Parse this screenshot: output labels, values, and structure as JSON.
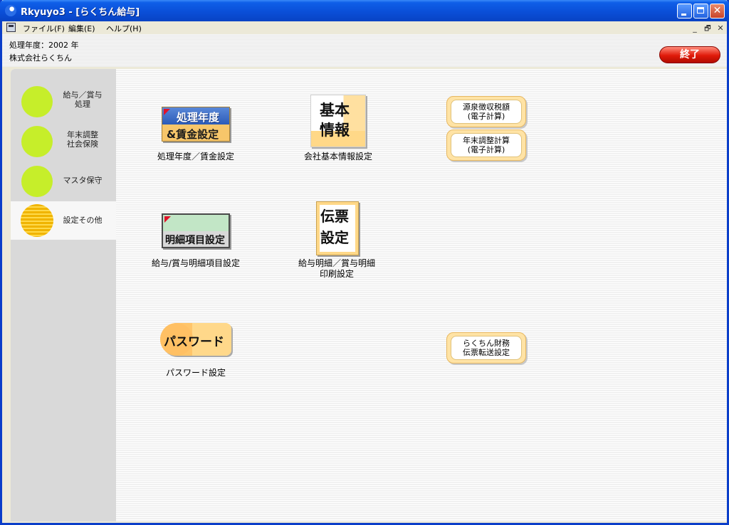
{
  "window": {
    "title": "Rkyuyo3 - [らくちん給与]",
    "buttons": {
      "minimize": "_",
      "maximize": "□",
      "close": "✕"
    }
  },
  "menu": {
    "items": [
      "ファイル(F)",
      "編集(E)",
      "ヘルプ(H)"
    ],
    "mdi": {
      "minimize": "_",
      "restore": "🗗",
      "close": "✕"
    }
  },
  "info": {
    "year_line": "処理年度：2002 年",
    "company": "株式会社らくちん",
    "exit_label": "終了"
  },
  "sidebar": {
    "items": [
      {
        "lines": [
          "給与／賞与",
          "処理"
        ]
      },
      {
        "lines": [
          "年末調整",
          "社会保険"
        ]
      },
      {
        "lines": [
          "マスタ保守"
        ]
      },
      {
        "lines": [
          "設定その他"
        ]
      }
    ],
    "active_index": 3
  },
  "icons": {
    "year": {
      "line1": "処理年度",
      "line2": "&賃金設定",
      "label": "処理年度／賃金設定"
    },
    "company": {
      "line1": "基本",
      "line2": "情報",
      "label": "会社基本情報設定"
    },
    "detail": {
      "text": "明細項目設定",
      "label": "給与/賞与明細項目設定"
    },
    "slip": {
      "line1": "伝票",
      "line2": "設定",
      "label_lines": [
        "給与明細／賞与明細",
        "印刷設定"
      ]
    },
    "password": {
      "text": "パスワード",
      "label": "パスワード設定"
    }
  },
  "small_buttons": {
    "withholding": [
      "源泉徴収税額",
      "(電子計算)"
    ],
    "yearend": [
      "年末調整計算",
      "(電子計算)"
    ],
    "transfer": [
      "らくちん財務",
      "伝票転送設定"
    ]
  },
  "colors": {
    "title_bar": "#0a4fd8",
    "side_circle": "#c6ee2a",
    "active_circle": "#f0b400",
    "exit_button": "#e01a0a",
    "button_fill": "#ffe3a5"
  }
}
